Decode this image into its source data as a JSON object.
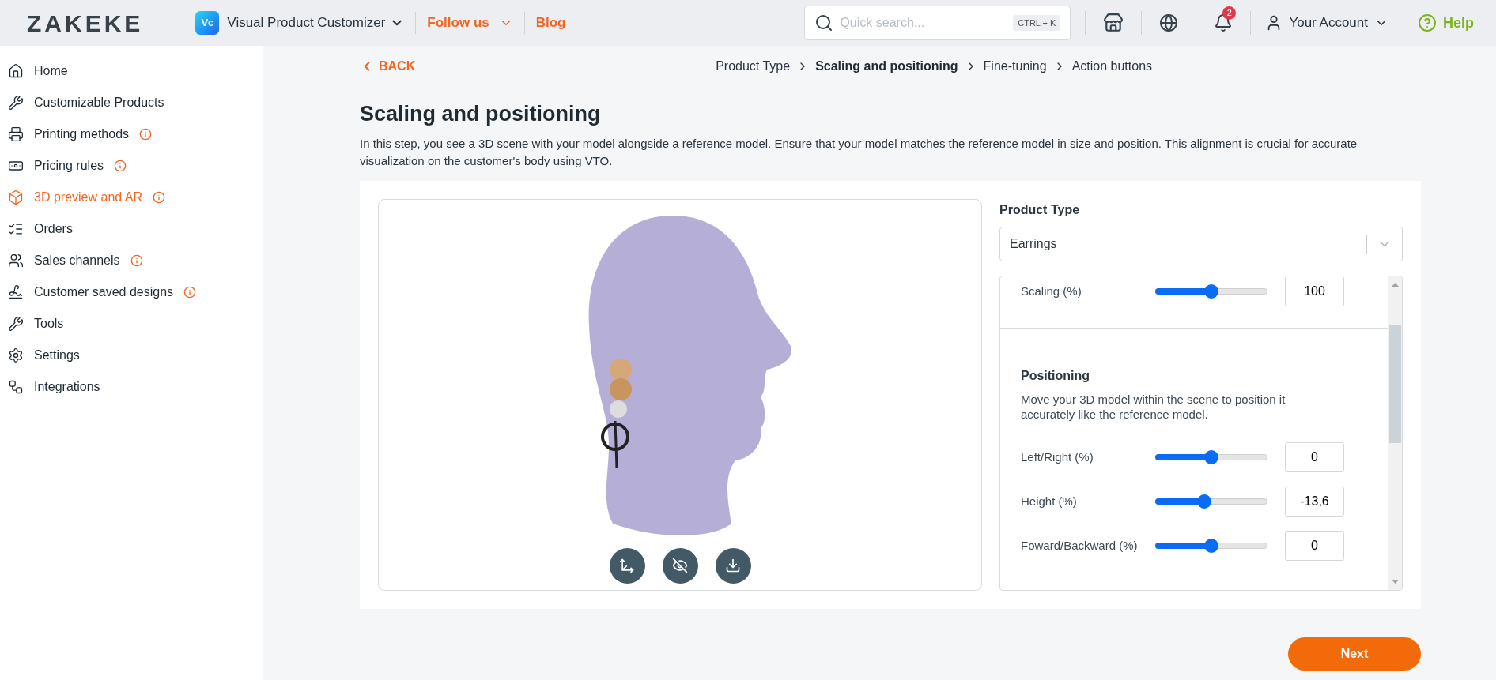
{
  "header": {
    "logo": "ZAKEKE",
    "app_badge": "Vc",
    "app_name": "Visual Product Customizer",
    "links": [
      {
        "label": "Follow us",
        "kind": "dropdown"
      },
      {
        "label": "Blog",
        "kind": "link"
      }
    ],
    "search": {
      "placeholder": "Quick search...",
      "shortcut": "CTRL + K"
    },
    "notifications": "2",
    "account": "Your Account",
    "help": "Help"
  },
  "sidebar": {
    "items": [
      {
        "label": "Home",
        "info": false,
        "selected": false
      },
      {
        "label": "Customizable Products",
        "info": false,
        "selected": false
      },
      {
        "label": "Printing methods",
        "info": true,
        "selected": false
      },
      {
        "label": "Pricing rules",
        "info": true,
        "selected": false
      },
      {
        "label": "3D preview and AR",
        "info": true,
        "selected": true
      },
      {
        "label": "Orders",
        "info": false,
        "selected": false
      },
      {
        "label": "Sales channels",
        "info": true,
        "selected": false
      },
      {
        "label": "Customer saved designs",
        "info": true,
        "selected": false
      },
      {
        "label": "Tools",
        "info": false,
        "selected": false
      },
      {
        "label": "Settings",
        "info": false,
        "selected": false
      },
      {
        "label": "Integrations",
        "info": false,
        "selected": false
      }
    ]
  },
  "back": "BACK",
  "breadcrumb": [
    {
      "label": "Product Type",
      "selected": false
    },
    {
      "label": "Scaling and positioning",
      "selected": true
    },
    {
      "label": "Fine-tuning",
      "selected": false
    },
    {
      "label": "Action buttons",
      "selected": false
    }
  ],
  "title": "Scaling and positioning",
  "description": "In this step, you see a 3D scene with your model alongside a reference model. Ensure that your model matches the reference model in size and position. This alignment is crucial for accurate visualization on the customer's body using VTO.",
  "product_type": {
    "label": "Product Type",
    "value": "Earrings"
  },
  "scaling": {
    "label": "Scaling (%)",
    "level": 0.5,
    "value": "100"
  },
  "positioning": {
    "heading": "Positioning",
    "text": "Move your 3D model within the scene to position it accurately like the reference model.",
    "rows": [
      {
        "label": "Left/Right (%)",
        "level": 0.5,
        "value": "0"
      },
      {
        "label": "Height (%)",
        "level": 0.44,
        "value": "-13,6"
      },
      {
        "label": "Foward/Backward (%)",
        "level": 0.5,
        "value": "0"
      }
    ]
  },
  "next": "Next"
}
